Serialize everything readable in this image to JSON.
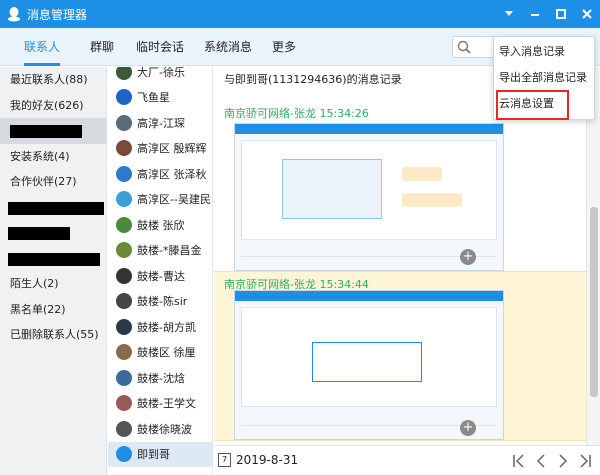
{
  "app": {
    "title": "消息管理器"
  },
  "tabs": [
    {
      "label": "联系人",
      "active": true
    },
    {
      "label": "群聊"
    },
    {
      "label": "临时会话"
    },
    {
      "label": "系统消息"
    },
    {
      "label": "更多"
    }
  ],
  "groups": [
    {
      "label": "最近联系人(88)"
    },
    {
      "label": "我的好友(626)",
      "selected": true
    },
    {
      "label": ""
    },
    {
      "label": "安装系统(4)"
    },
    {
      "label": "合作伙伴(27)"
    },
    {
      "label": ""
    },
    {
      "label": ""
    },
    {
      "label": ""
    },
    {
      "label": "陌生人(2)"
    },
    {
      "label": "黑名单(22)"
    },
    {
      "label": "已删除联系人(55)"
    }
  ],
  "contacts": [
    {
      "name": "大厂-徐乐",
      "color": "#3d5a3a"
    },
    {
      "name": "飞鱼星",
      "color": "#1e64c8"
    },
    {
      "name": "高淳-江琛",
      "color": "#5b6b7a"
    },
    {
      "name": "高淳区 殷辉辉",
      "color": "#7a4b3a"
    },
    {
      "name": "高淳区 张泽秋",
      "color": "#2c7ac9"
    },
    {
      "name": "高淳区--吴建民",
      "color": "#3aa0d6"
    },
    {
      "name": "鼓楼 张欣",
      "color": "#4a8a3a"
    },
    {
      "name": "鼓楼-*滕昌金",
      "color": "#6a8a3a"
    },
    {
      "name": "鼓楼-曹达",
      "color": "#333333"
    },
    {
      "name": "鼓楼-陈sir",
      "color": "#444444"
    },
    {
      "name": "鼓楼-胡方凯",
      "color": "#2a3a4a"
    },
    {
      "name": "鼓楼区 徐厘",
      "color": "#8a6a4a"
    },
    {
      "name": "鼓楼-沈焓",
      "color": "#3a6a9a"
    },
    {
      "name": "鼓楼-王学文",
      "color": "#9a5a5a"
    },
    {
      "name": "鼓楼徐晓波",
      "color": "#555555"
    },
    {
      "name": "即到哥",
      "color": "#1e8fe6",
      "selected": true
    }
  ],
  "history": {
    "heading": "与即到哥(1131294636)的消息记录",
    "messages": [
      {
        "sender_time": "南京骄可网络-张龙 15:34:26"
      },
      {
        "sender_time": "南京骄可网络-张龙 15:34:44"
      }
    ],
    "date": "2019-8-31"
  },
  "menu": {
    "items": [
      {
        "label": "导入消息记录"
      },
      {
        "label": "导出全部消息记录"
      },
      {
        "label": "云消息设置"
      }
    ]
  },
  "colors": {
    "accent": "#1e8fe6",
    "sender": "#2fae5c",
    "highlight": "#e52828"
  },
  "icons": {
    "search": "search-icon",
    "zoom": "zoom-in-icon",
    "calendar": "calendar-icon"
  }
}
